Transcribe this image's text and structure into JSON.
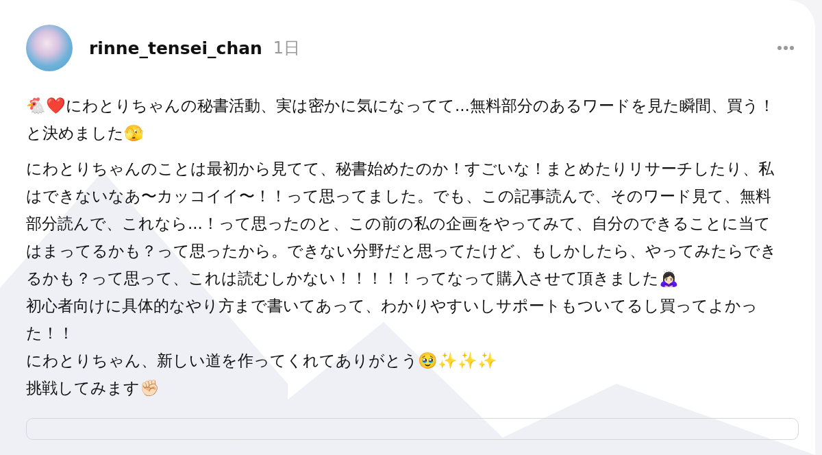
{
  "post": {
    "author": "rinne_tensei_chan",
    "time": "1日",
    "paragraphs": [
      [
        "🐔❤️にわとりちゃんの秘書活動、実は密かに気になってて...無料部分のあるワードを見た瞬間、買う！と決めました🫣"
      ],
      [
        "にわとりちゃんのことは最初から見てて、秘書始めたのか！すごいな！まとめたりリサーチしたり、私はできないなあ〜カッコイイ〜！！って思ってました。でも、この記事読んで、そのワード見て、無料部分読んで、これなら...！って思ったのと、この前の私の企画をやってみて、自分のできることに当てはまってるかも？って思ったから。できない分野だと思ってたけど、もしかしたら、やってみたらできるかも？って思って、これは読むしかない！！！！！ってなって購入させて頂きました🙇🏻‍♀️",
        "初心者向けに具体的なやり方まで書いてあって、わかりやすいしサポートもついてるし買ってよかった！！",
        "にわとりちゃん、新しい道を作ってくれてありがとう🥹✨✨✨",
        "挑戦してみます✊🏻"
      ]
    ]
  }
}
